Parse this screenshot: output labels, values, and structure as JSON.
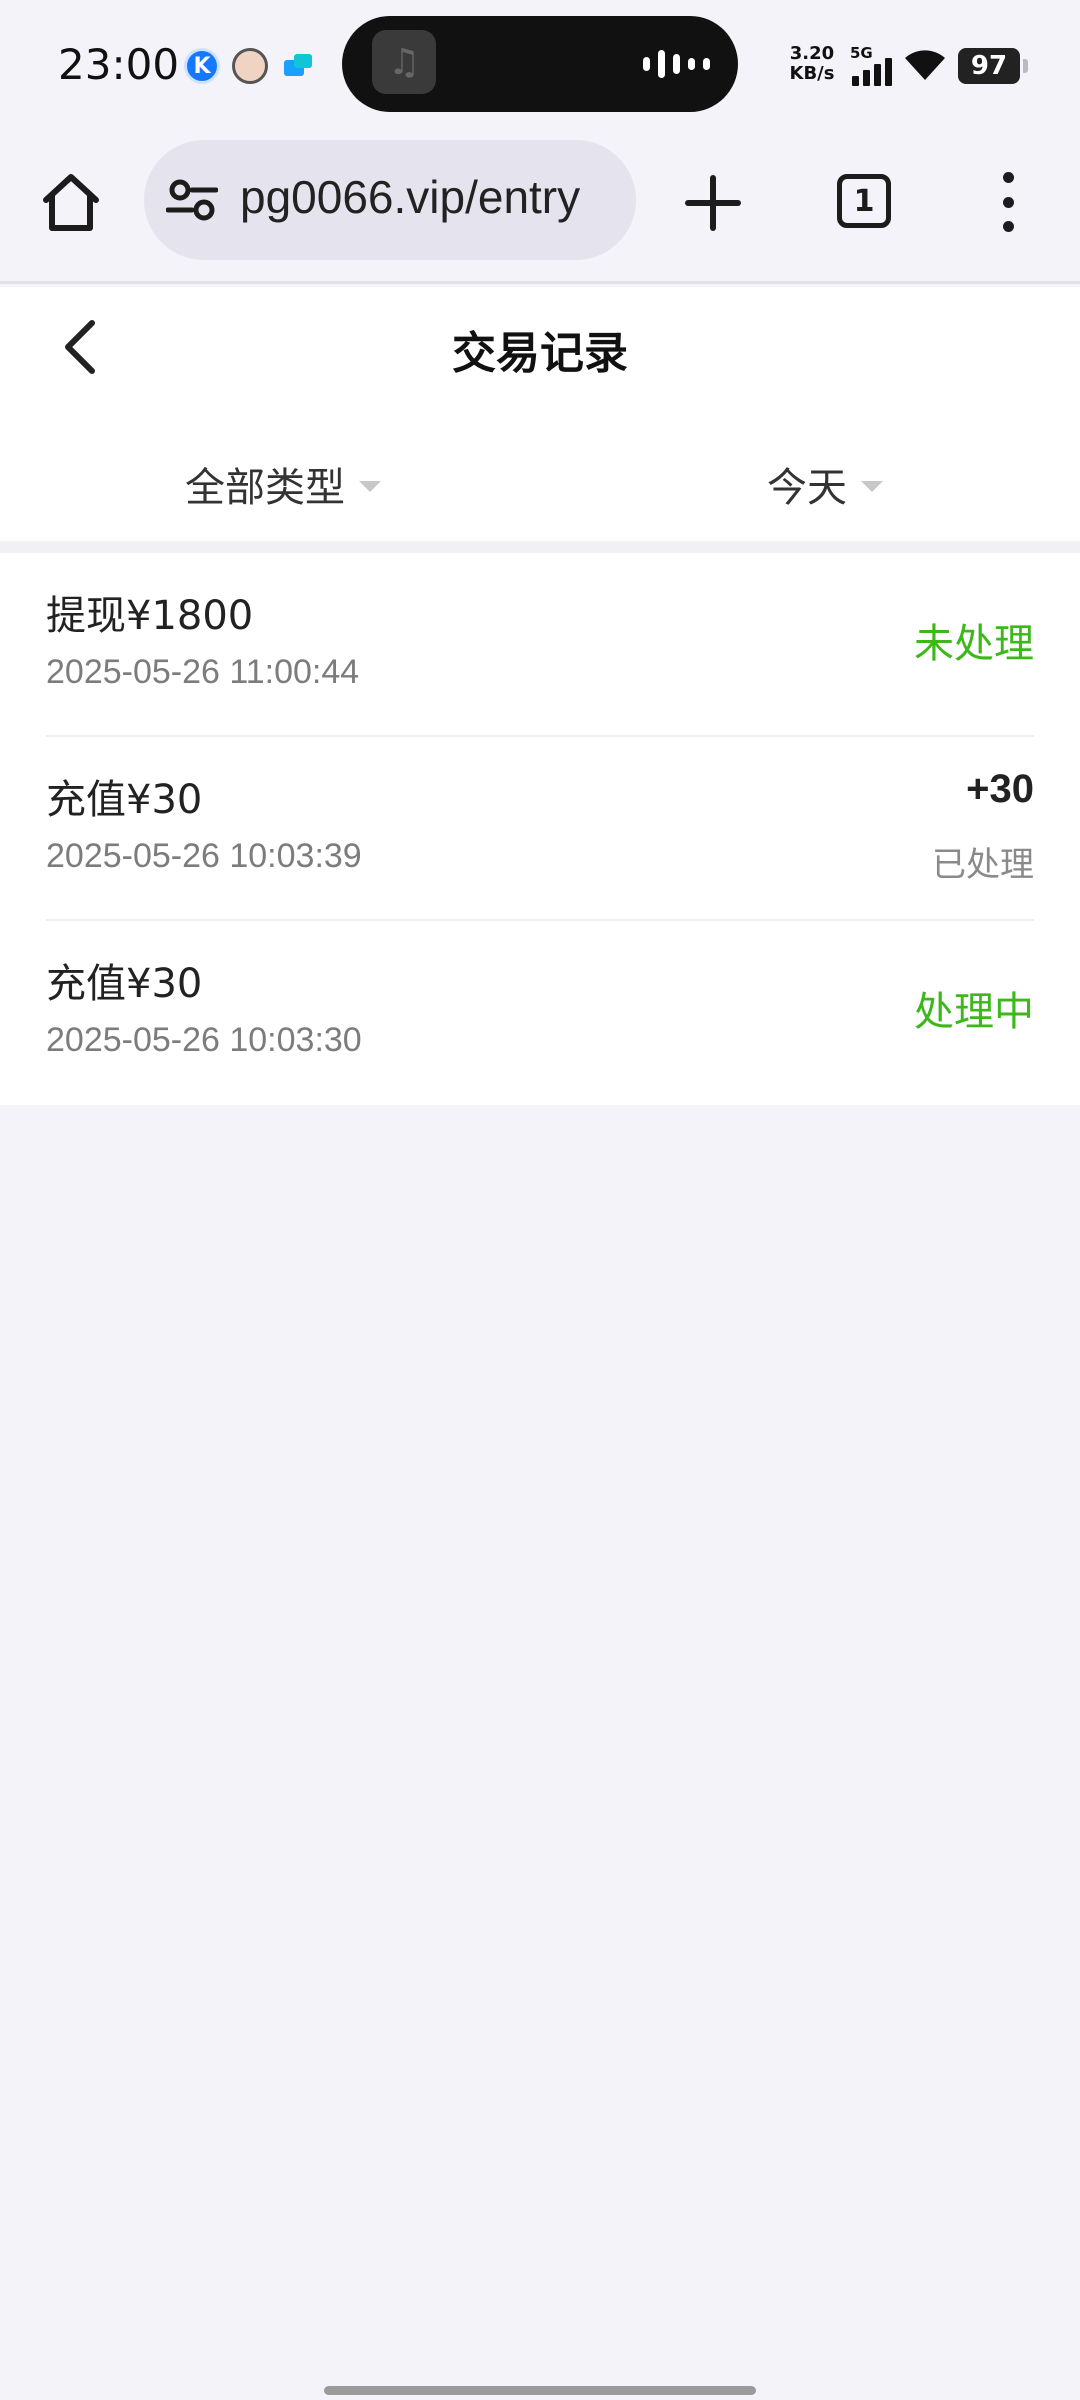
{
  "status_bar": {
    "time": "23:00",
    "notif_k": "K",
    "net_speed_value": "3.20",
    "net_speed_unit": "KB/s",
    "network": "5G",
    "battery": "97"
  },
  "browser": {
    "url": "pg0066.vip/entry",
    "tab_count": "1"
  },
  "header": {
    "title": "交易记录"
  },
  "filters": {
    "type_label": "全部类型",
    "date_label": "今天"
  },
  "transactions": [
    {
      "title": "提现¥1800",
      "time": "2025-05-26 11:00:44",
      "status": "未处理"
    },
    {
      "title": "充值¥30",
      "time": "2025-05-26 10:03:39",
      "amount": "+30",
      "status": "已处理"
    },
    {
      "title": "充值¥30",
      "time": "2025-05-26 10:03:30",
      "status": "处理中"
    }
  ],
  "colors": {
    "status_pending": "#3cb81a",
    "status_done": "#8a8a8a",
    "background": "#f4f3f9"
  }
}
